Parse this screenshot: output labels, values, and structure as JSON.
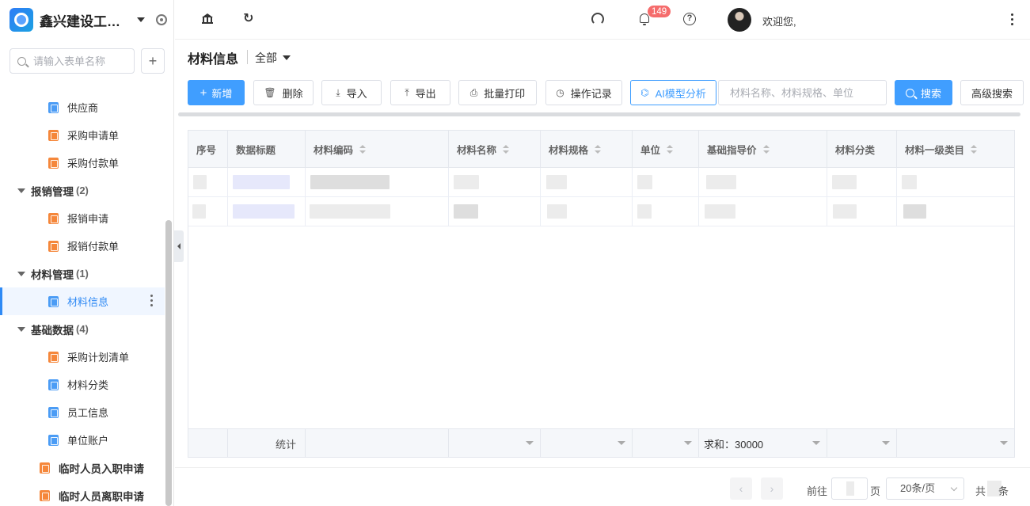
{
  "app": {
    "name": "鑫兴建设工程..."
  },
  "sidebar": {
    "search_placeholder": "请输入表单名称",
    "add_label": "+",
    "items": [
      {
        "type": "leaf",
        "label": "供应商",
        "color": "#4b9cf5"
      },
      {
        "type": "leaf",
        "label": "采购申请单",
        "color": "#f5873b"
      },
      {
        "type": "leaf",
        "label": "采购付款单",
        "color": "#f5873b"
      },
      {
        "type": "group",
        "label": "报销管理",
        "count": "(2)"
      },
      {
        "type": "leaf",
        "label": "报销申请",
        "color": "#f5873b"
      },
      {
        "type": "leaf",
        "label": "报销付款单",
        "color": "#f5873b"
      },
      {
        "type": "group",
        "label": "材料管理",
        "count": "(1)"
      },
      {
        "type": "leaf",
        "label": "材料信息",
        "color": "#4b9cf5",
        "active": true
      },
      {
        "type": "group",
        "label": "基础数据",
        "count": "(4)"
      },
      {
        "type": "leaf",
        "label": "采购计划清单",
        "color": "#f5873b"
      },
      {
        "type": "leaf",
        "label": "材料分类",
        "color": "#4b9cf5"
      },
      {
        "type": "leaf",
        "label": "员工信息",
        "color": "#4b9cf5"
      },
      {
        "type": "leaf",
        "label": "单位账户",
        "color": "#4b9cf5"
      },
      {
        "type": "top",
        "label": "临时人员入职申请",
        "color": "#f5873b"
      },
      {
        "type": "top",
        "label": "临时人员离职申请",
        "color": "#f5873b"
      }
    ]
  },
  "header": {
    "notification_count": "149",
    "welcome": "欢迎您,",
    "refresh_glyph": "↻",
    "help_glyph": "?"
  },
  "page": {
    "title": "材料信息",
    "view": "全部"
  },
  "toolbar": {
    "add": "新增",
    "add_glyph": "+",
    "delete": "删除",
    "delete_glyph": "🗑",
    "import": "导入",
    "import_glyph": "⤓",
    "export": "导出",
    "export_glyph": "⤒",
    "batch_print": "批量打印",
    "print_glyph": "⎙",
    "operation_log": "操作记录",
    "log_glyph": "◷",
    "ai_analysis": "AI模型分析",
    "ai_glyph": "⌬",
    "search_placeholder": "材料名称、材料规格、单位",
    "search": "搜索",
    "advanced_search": "高级搜索"
  },
  "table": {
    "columns": [
      "序号",
      "数据标题",
      "材料编码",
      "材料名称",
      "材料规格",
      "单位",
      "基础指导价",
      "材料分类",
      "材料一级类目"
    ],
    "footer_label": "统计",
    "footer_sum": "求和：30000"
  },
  "pagination": {
    "prev": "‹",
    "next": "›",
    "goto": "前往",
    "page_unit": "页",
    "page_size": "20条/页",
    "total_prefix": "共",
    "total_suffix": "条"
  }
}
